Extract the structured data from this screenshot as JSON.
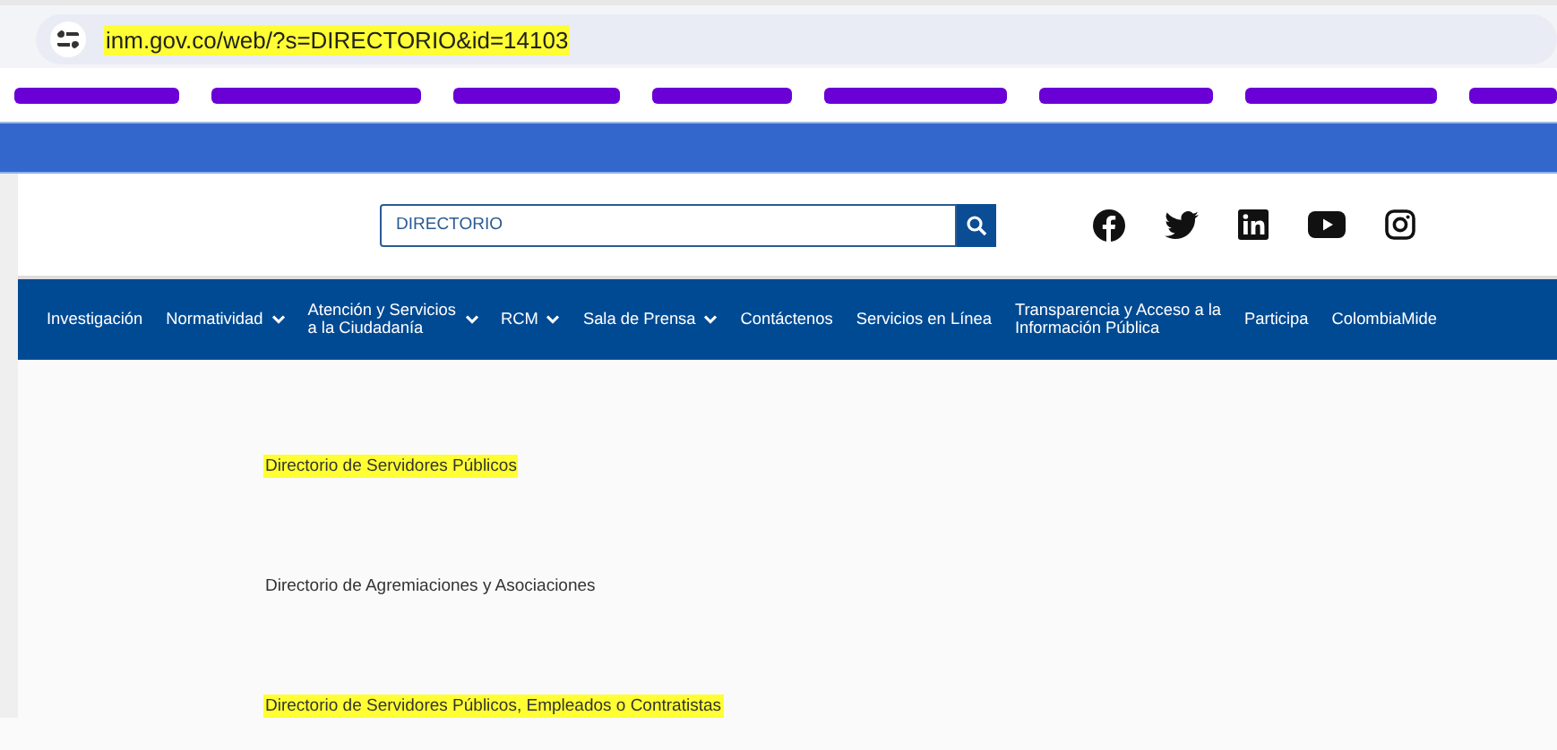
{
  "address_bar": {
    "url": "inm.gov.co/web/?s=DIRECTORIO&id=14103",
    "highlighted": true
  },
  "bookmarks_redacted": [
    {
      "kind": "redacted"
    },
    {
      "kind": "redacted"
    },
    {
      "kind": "redacted"
    },
    {
      "kind": "redacted"
    },
    {
      "kind": "redacted"
    },
    {
      "kind": "redacted"
    },
    {
      "kind": "redacted"
    },
    {
      "kind": "redacted"
    }
  ],
  "search": {
    "value": "DIRECTORIO"
  },
  "social": [
    {
      "kind": "facebook"
    },
    {
      "kind": "twitter"
    },
    {
      "kind": "linkedin"
    },
    {
      "kind": "youtube"
    },
    {
      "kind": "instagram"
    }
  ],
  "nav": [
    {
      "label": "Investigación",
      "dropdown": false
    },
    {
      "label": "Normatividad",
      "dropdown": true
    },
    {
      "label": "Atención y Servicios\na la Ciudadanía",
      "dropdown": true
    },
    {
      "label": "RCM",
      "dropdown": true
    },
    {
      "label": "Sala de Prensa",
      "dropdown": true
    },
    {
      "label": "Contáctenos",
      "dropdown": false
    },
    {
      "label": "Servicios en Línea",
      "dropdown": false
    },
    {
      "label": "Transparencia y Acceso a la\nInformación Pública",
      "dropdown": false
    },
    {
      "label": "Participa",
      "dropdown": false
    },
    {
      "label": "ColombiaMide",
      "dropdown": false
    }
  ],
  "links": [
    {
      "text": "Directorio de Servidores Públicos",
      "highlighted": true
    },
    {
      "text": "Directorio de Agremiaciones y Asociaciones",
      "highlighted": false
    },
    {
      "text": "Directorio de Servidores Públicos, Empleados o Contratistas",
      "highlighted": true
    }
  ]
}
